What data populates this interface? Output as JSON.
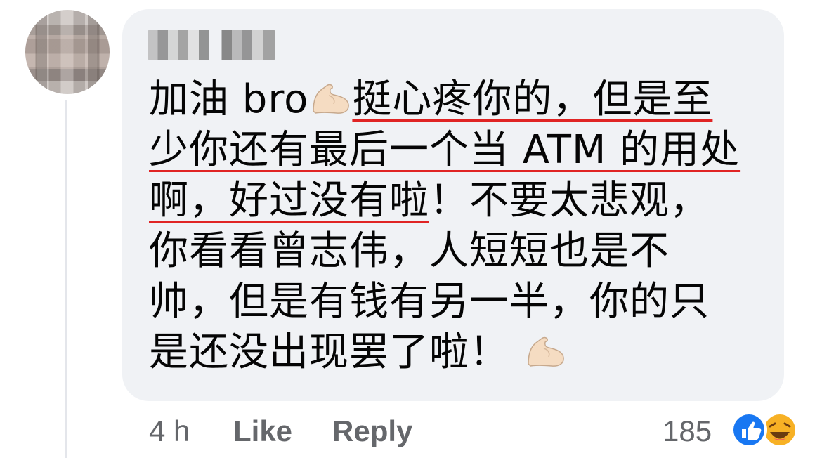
{
  "comment": {
    "lines": [
      {
        "pre": "加油 bro",
        "underlined": "挺心疼你的，但是至",
        "post": ""
      },
      {
        "pre": "",
        "underlined": "少你还有最后一个当 ATM 的用处",
        "post": ""
      },
      {
        "pre": "",
        "underlined": "啊，好过没有啦",
        "post": "！不要太悲观，"
      },
      {
        "pre": "你看看曾志伟，人短短也是不",
        "underlined": "",
        "post": ""
      },
      {
        "pre": "帅，但是有钱有另一半，你的只",
        "underlined": "",
        "post": ""
      },
      {
        "pre": "是还没出现罢了啦！",
        "underlined": "",
        "post": ""
      }
    ],
    "emoji": "flexed-biceps",
    "underline_color": "#e02424"
  },
  "actions": {
    "time": "4 h",
    "like": "Like",
    "reply": "Reply",
    "reaction_count": "185",
    "reactions": [
      "like",
      "haha"
    ]
  }
}
